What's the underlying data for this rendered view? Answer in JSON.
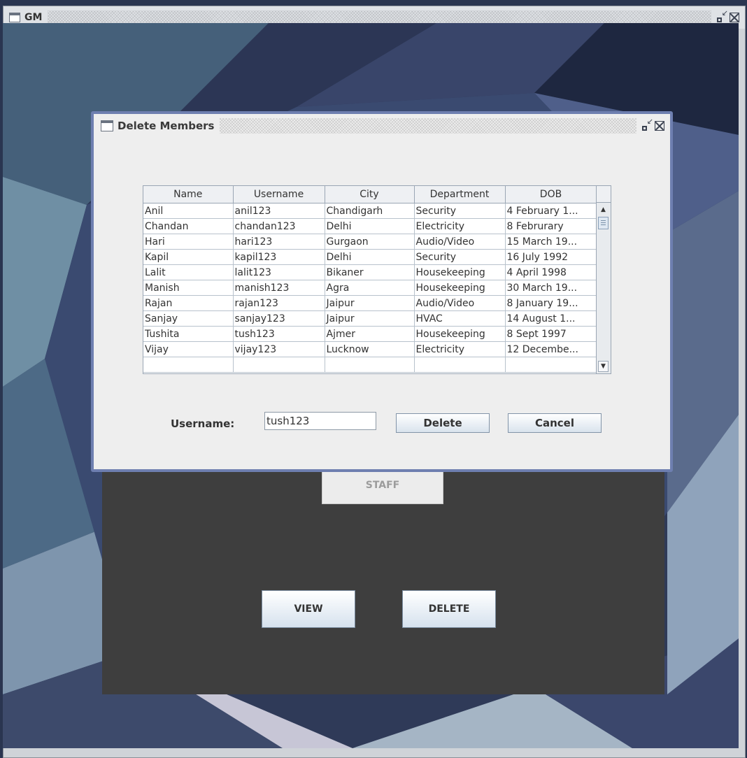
{
  "main_window": {
    "title": "GM"
  },
  "dialog": {
    "title": "Delete Members",
    "table": {
      "columns": [
        "Name",
        "Username",
        "City",
        "Department",
        "DOB"
      ],
      "rows": [
        [
          "Anil",
          "anil123",
          "Chandigarh",
          "Security",
          "4 February 1..."
        ],
        [
          "Chandan",
          "chandan123",
          "Delhi",
          "Electricity",
          "8 Februrary"
        ],
        [
          "Hari",
          "hari123",
          "Gurgaon",
          "Audio/Video",
          "15 March 19..."
        ],
        [
          "Kapil",
          "kapil123",
          "Delhi",
          "Security",
          "16 July 1992"
        ],
        [
          "Lalit",
          "lalit123",
          "Bikaner",
          "Housekeeping",
          "4 April 1998"
        ],
        [
          "Manish",
          "manish123",
          "Agra",
          "Housekeeping",
          "30 March 19..."
        ],
        [
          "Rajan",
          "rajan123",
          "Jaipur",
          "Audio/Video",
          "8 January 19..."
        ],
        [
          "Sanjay",
          "sanjay123",
          "Jaipur",
          "HVAC",
          "14 August 1..."
        ],
        [
          "Tushita",
          "tush123",
          "Ajmer",
          "Housekeeping",
          "8 Sept 1997"
        ],
        [
          "Vijay",
          "vijay123",
          "Lucknow",
          "Electricity",
          "12 Decembe..."
        ],
        [
          "",
          "",
          "",
          "",
          ""
        ]
      ]
    },
    "username_label": "Username:",
    "username_value": "tush123",
    "delete_label": "Delete",
    "cancel_label": "Cancel"
  },
  "panel": {
    "staff_label": "STAFF",
    "view_label": "VIEW",
    "delete_label": "DELETE"
  },
  "colors": {
    "dialog_border": "#6e7fb0",
    "panel_bg": "#3e3e3e"
  }
}
